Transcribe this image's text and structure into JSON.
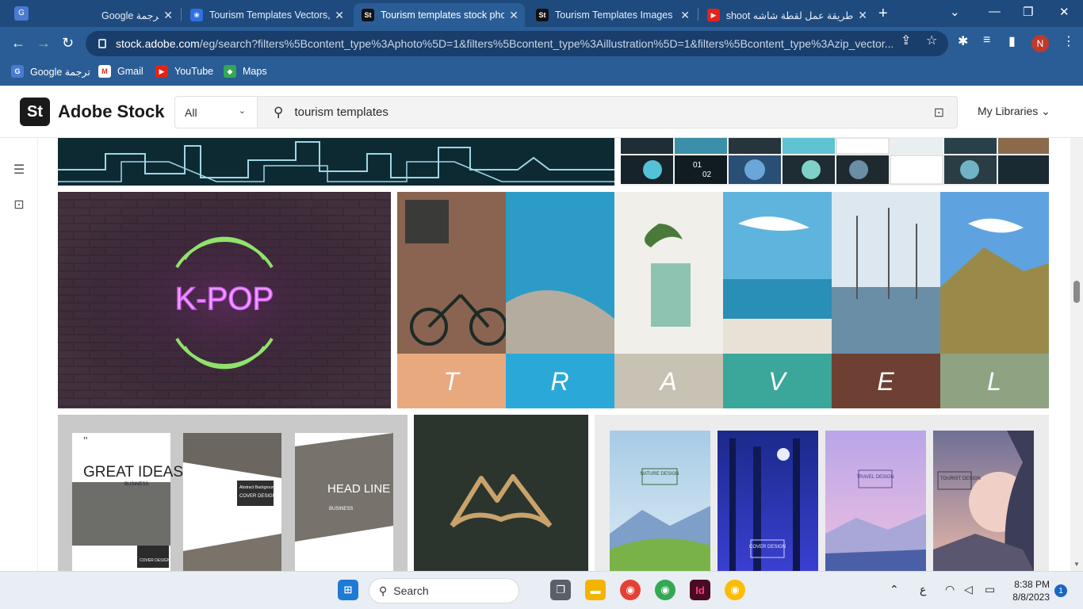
{
  "browser": {
    "tabs": [
      {
        "title": "Google ترجمة",
        "favicon": "google-translate-icon",
        "active": false
      },
      {
        "title": "Tourism Templates Vectors, P",
        "favicon": "freepik-icon",
        "active": false
      },
      {
        "title": "Tourism templates stock phot",
        "favicon": "adobe-stock-icon",
        "active": true
      },
      {
        "title": "Tourism Templates Images –",
        "favicon": "adobe-stock-icon",
        "active": false
      },
      {
        "title": "طريقة عمل لقطة شاشه shoot",
        "favicon": "youtube-icon",
        "active": false
      }
    ],
    "url_host": "stock.adobe.com",
    "url_rest": "/eg/search?filters%5Bcontent_type%3Aphoto%5D=1&filters%5Bcontent_type%3Aillustration%5D=1&filters%5Bcontent_type%3Azip_vector...",
    "profile_initial": "N",
    "bookmarks": [
      {
        "label": "Google ترجمة",
        "icon": "google-translate-icon"
      },
      {
        "label": "Gmail",
        "icon": "gmail-icon"
      },
      {
        "label": "YouTube",
        "icon": "youtube-icon"
      },
      {
        "label": "Maps",
        "icon": "maps-icon"
      }
    ]
  },
  "stock": {
    "logo_mark": "St",
    "logo_text": "Adobe Stock",
    "category": "All",
    "query": "tourism templates",
    "my_libraries": "My Libraries"
  },
  "results": {
    "travel_letters": [
      "T",
      "R",
      "A",
      "V",
      "E",
      "L"
    ],
    "kpop_text": "K-POP",
    "brochure_1_title": "GREAT IDEAS",
    "brochure_1_sub": "BUSINESS",
    "brochure_1_cover": "COVER DESIGN",
    "brochure_2_label": "Abstract Background",
    "brochure_2_cover": "COVER DESIGN",
    "brochure_3_title": "HEAD LINE",
    "brochure_3_sub": "BUSINESS",
    "poster_labels": [
      "NATURE DESIGN",
      "COVER DESIGN",
      "TRAVEL DESIGN",
      "TOURIST DESIGN"
    ],
    "slide_numbers": "01 02"
  },
  "taskbar": {
    "search_label": "Search",
    "time": "8:38 PM",
    "date": "8/8/2023",
    "notifications": "1",
    "lang": "ع"
  },
  "colors": {
    "tabbar": "#1e4a7e",
    "toolbar": "#2a5d95",
    "travel_letter_bars": [
      "#e9a97f",
      "#2aa9d9",
      "#c8c2b4",
      "#3aa79a",
      "#6e4034",
      "#8fa383"
    ]
  }
}
